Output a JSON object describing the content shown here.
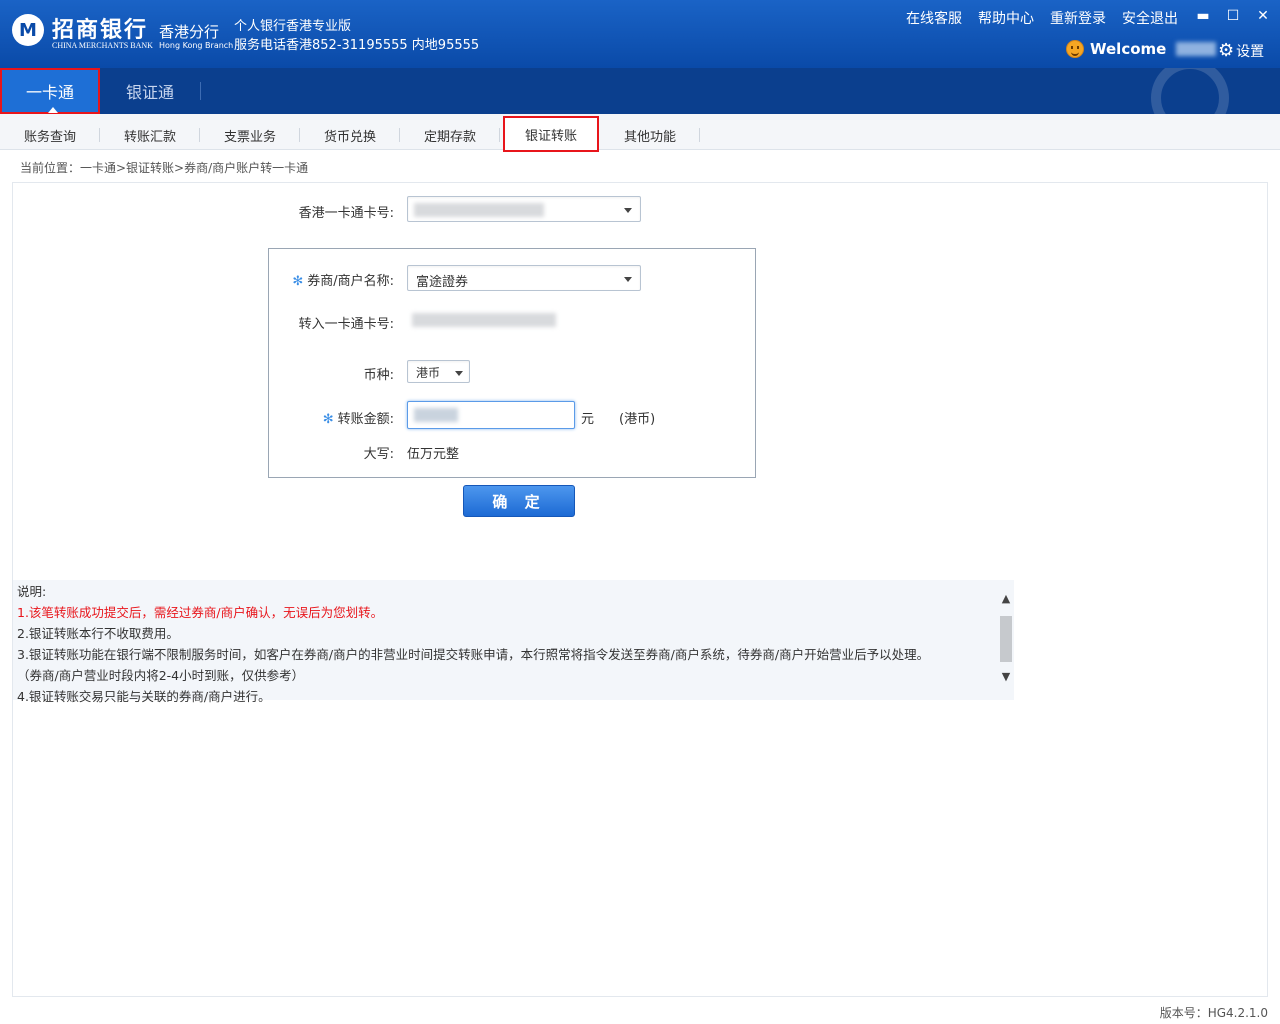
{
  "header": {
    "bank_name_cn": "招商银行",
    "bank_name_en": "CHINA MERCHANTS BANK",
    "branch_cn": "香港分行",
    "branch_en": "Hong Kong Branch",
    "edition": "个人银行香港专业版",
    "hotline": "服务电话香港852-31195555 内地95555",
    "links": [
      "在线客服",
      "帮助中心",
      "重新登录",
      "安全退出"
    ],
    "welcome": "Welcome",
    "settings": "设置"
  },
  "main_tabs": [
    "一卡通",
    "银证通"
  ],
  "sub_nav": [
    "账务查询",
    "转账汇款",
    "支票业务",
    "货币兑换",
    "定期存款",
    "银证转账",
    "其他功能"
  ],
  "breadcrumb": "当前位置：一卡通>银证转账>券商/商户账户转一卡通",
  "form": {
    "card_label": "香港一卡通卡号:",
    "broker_label": "券商/商户名称:",
    "broker_value": "富途證券",
    "target_card_label": "转入一卡通卡号:",
    "currency_label": "币种:",
    "currency_value": "港币",
    "amount_label": "转账金额:",
    "amount_unit": "元",
    "amount_currency": "(港币)",
    "capital_label": "大写:",
    "capital_value": "伍万元整",
    "confirm": "确 定"
  },
  "notes": {
    "title": "说明:",
    "lines": [
      "1.该笔转账成功提交后，需经过券商/商户确认，无误后为您划转。",
      "2.银证转账本行不收取费用。",
      "3.银证转账功能在银行端不限制服务时间，如客户在券商/商户的非营业时间提交转账申请，本行照常将指令发送至券商/商户系统，待券商/商户开始营业后予以处理。",
      "（券商/商户营业时段内将2-4小时到账，仅供参考）",
      "4.银证转账交易只能与关联的券商/商户进行。"
    ]
  },
  "version": "版本号：HG4.2.1.0",
  "colors": {
    "header_blue": "#0a4aa8",
    "highlight_red": "#e8151b",
    "accent_blue": "#1e6fd6"
  }
}
